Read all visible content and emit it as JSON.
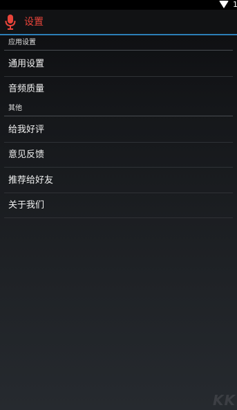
{
  "status_bar": {
    "battery_text": "1",
    "wifi_icon": "wifi-icon"
  },
  "action_bar": {
    "icon": "microphone-icon",
    "title": "设置",
    "title_color": "#e8443a",
    "underline_color": "#2c7fb8"
  },
  "sections": [
    {
      "header": "应用设置",
      "items": [
        {
          "label": "通用设置"
        },
        {
          "label": "音频质量"
        }
      ]
    },
    {
      "header": "其他",
      "items": [
        {
          "label": "给我好评"
        },
        {
          "label": "意见反馈"
        },
        {
          "label": "推荐给好友"
        },
        {
          "label": "关于我们"
        }
      ]
    }
  ],
  "watermark": "KK"
}
